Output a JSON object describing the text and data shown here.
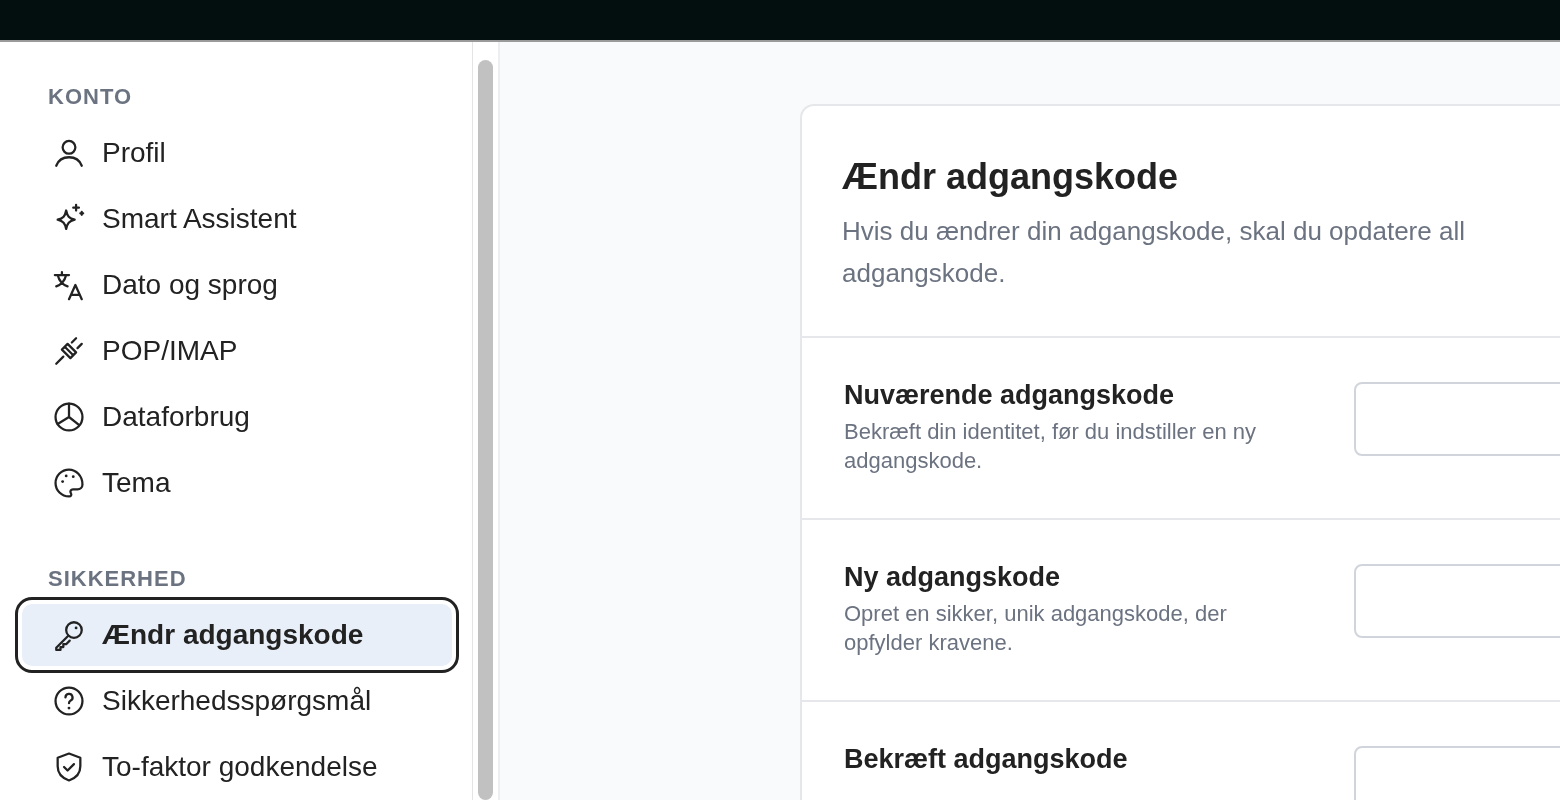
{
  "sidebar": {
    "sections": [
      {
        "heading": "KONTO",
        "items": [
          {
            "label": "Profil",
            "selected": false
          },
          {
            "label": "Smart Assistent",
            "selected": false
          },
          {
            "label": "Dato og sprog",
            "selected": false
          },
          {
            "label": "POP/IMAP",
            "selected": false
          },
          {
            "label": "Dataforbrug",
            "selected": false
          },
          {
            "label": "Tema",
            "selected": false
          }
        ]
      },
      {
        "heading": "SIKKERHED",
        "items": [
          {
            "label": "Ændr adgangskode",
            "selected": true
          },
          {
            "label": "Sikkerhedsspørgsmål",
            "selected": false
          },
          {
            "label": "To-faktor godkendelse",
            "selected": false
          }
        ]
      }
    ]
  },
  "card": {
    "title": "Ændr adgangskode",
    "description": "Hvis du ændrer din adgangskode, skal du opdatere all\nadgangskode.",
    "fields": [
      {
        "label": "Nuværende adgangskode",
        "hint": "Bekræft din identitet, før du indstiller en ny adgangskode."
      },
      {
        "label": "Ny adgangskode",
        "hint": "Opret en sikker, unik adgangskode, der opfylder kravene."
      },
      {
        "label": "Bekræft adgangskode"
      }
    ]
  }
}
